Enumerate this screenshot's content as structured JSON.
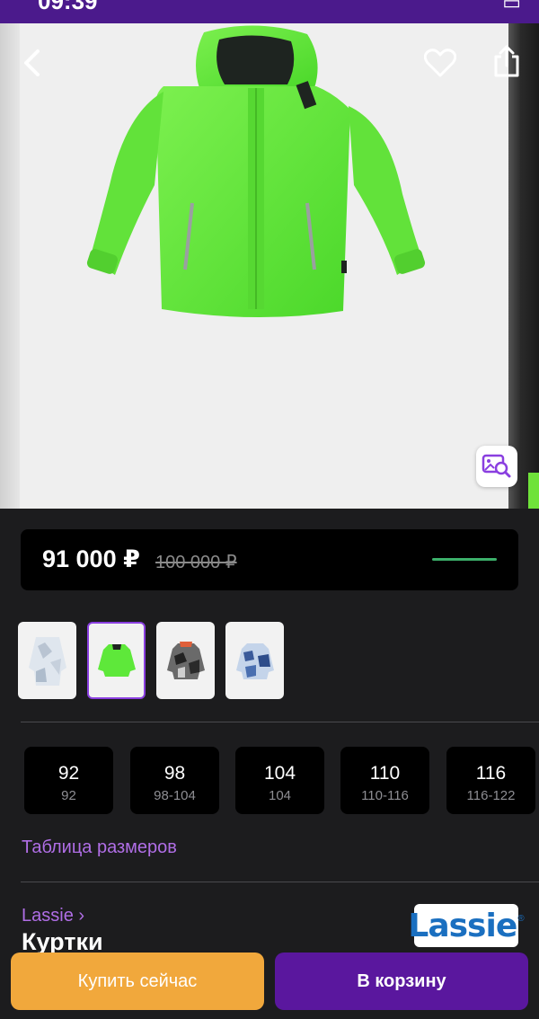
{
  "status_bar": {
    "time": "09:39"
  },
  "product": {
    "price_current": "91 000 ₽",
    "price_old": "100 000 ₽",
    "colors": [
      "light-gray-camo",
      "lime-green",
      "black-gray-camo",
      "blue-camo"
    ],
    "selected_color_index": 1
  },
  "sizes": [
    {
      "main": "92",
      "sub": "92"
    },
    {
      "main": "98",
      "sub": "98-104"
    },
    {
      "main": "104",
      "sub": "104"
    },
    {
      "main": "110",
      "sub": "110-116"
    },
    {
      "main": "116",
      "sub": "116-122"
    }
  ],
  "size_table_label": "Таблица размеров",
  "brand": {
    "link_label": "Lassie ›",
    "logo_text": "Lassie",
    "logo_mark": "®"
  },
  "category_title": "Куртки",
  "actions": {
    "buy_now": "Купить сейчас",
    "add_to_cart": "В корзину"
  },
  "icons": {
    "back": "chevron-left-icon",
    "favorite": "heart-icon",
    "share": "share-icon",
    "visual_search": "image-search-icon"
  },
  "colors": {
    "status_bar": "#4b1a8c",
    "accent_purple": "#b06ee6",
    "buy_button": "#f1a83c",
    "cart_button": "#5a179e",
    "jacket_green": "#5ee83a"
  }
}
